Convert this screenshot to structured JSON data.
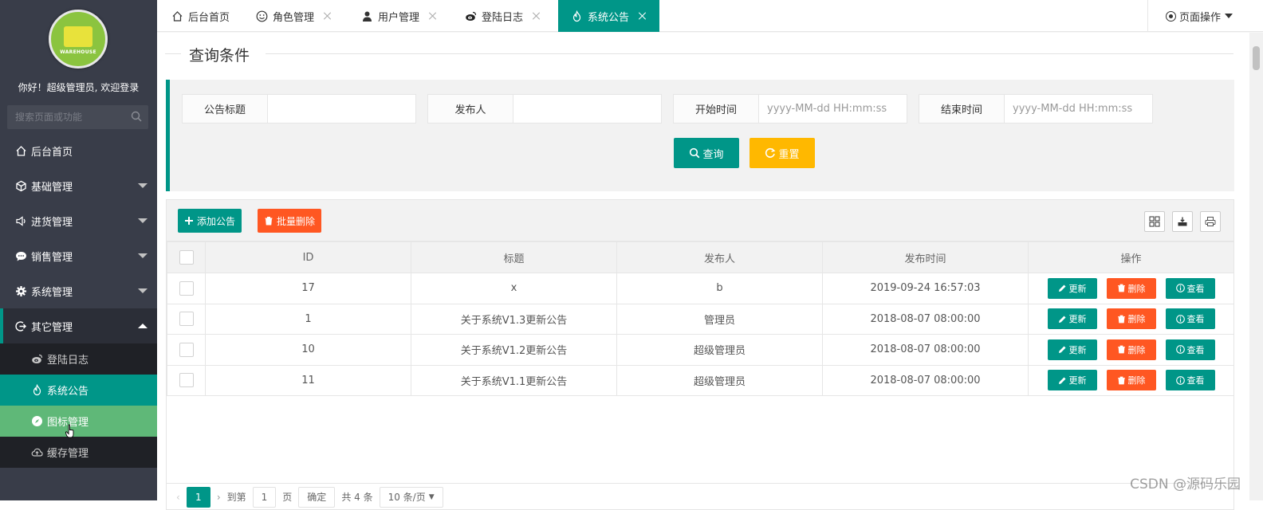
{
  "sidebar": {
    "logo_text": "WAREHOUSE",
    "welcome": "你好！超级管理员, 欢迎登录",
    "search_placeholder": "搜索页面或功能",
    "menu": [
      {
        "label": "后台首页",
        "icon": "home-icon"
      },
      {
        "label": "基础管理",
        "icon": "cube-icon",
        "expandable": true
      },
      {
        "label": "进货管理",
        "icon": "speaker-icon",
        "expandable": true
      },
      {
        "label": "销售管理",
        "icon": "chat-icon",
        "expandable": true
      },
      {
        "label": "系统管理",
        "icon": "gear-icon",
        "expandable": true
      },
      {
        "label": "其它管理",
        "icon": "exit-icon",
        "expandable": true,
        "open": true
      }
    ],
    "submenu": [
      {
        "label": "登陆日志",
        "icon": "weibo-icon"
      },
      {
        "label": "系统公告",
        "icon": "fire-icon",
        "state": "active"
      },
      {
        "label": "图标管理",
        "icon": "compass-icon",
        "state": "hover"
      },
      {
        "label": "缓存管理",
        "icon": "cloud-icon"
      }
    ]
  },
  "tabs": [
    {
      "label": "后台首页",
      "icon": "home-icon",
      "closable": false
    },
    {
      "label": "角色管理",
      "icon": "smile-icon",
      "closable": true
    },
    {
      "label": "用户管理",
      "icon": "user-icon",
      "closable": true
    },
    {
      "label": "登陆日志",
      "icon": "weibo-icon",
      "closable": true
    },
    {
      "label": "系统公告",
      "icon": "fire-icon",
      "closable": true,
      "active": true
    }
  ],
  "page_ops": "页面操作",
  "query": {
    "legend": "查询条件",
    "fields": [
      {
        "label": "公告标题",
        "placeholder": ""
      },
      {
        "label": "发布人",
        "placeholder": ""
      },
      {
        "label": "开始时间",
        "placeholder": "yyyy-MM-dd HH:mm:ss"
      },
      {
        "label": "结束时间",
        "placeholder": "yyyy-MM-dd HH:mm:ss"
      }
    ],
    "search_label": "查询",
    "reset_label": "重置"
  },
  "toolbar": {
    "add_label": "添加公告",
    "batch_delete_label": "批量删除"
  },
  "table": {
    "columns": [
      "ID",
      "标题",
      "发布人",
      "发布时间",
      "操作"
    ],
    "rows": [
      {
        "id": "17",
        "title": "x",
        "publisher": "b",
        "time": "2019-09-24 16:57:03"
      },
      {
        "id": "1",
        "title": "关于系统V1.3更新公告",
        "publisher": "管理员",
        "time": "2018-08-07 08:00:00"
      },
      {
        "id": "10",
        "title": "关于系统V1.2更新公告",
        "publisher": "超级管理员",
        "time": "2018-08-07 08:00:00"
      },
      {
        "id": "11",
        "title": "关于系统V1.1更新公告",
        "publisher": "超级管理员",
        "time": "2018-08-07 08:00:00"
      }
    ],
    "actions": {
      "update": "更新",
      "delete": "删除",
      "view": "查看"
    }
  },
  "pager": {
    "current": "1",
    "goto_prefix": "到第",
    "goto_value": "1",
    "goto_suffix": "页",
    "confirm": "确定",
    "total": "共 4 条",
    "per_page": "10 条/页"
  },
  "watermark": "CSDN @源码乐园",
  "colors": {
    "sidebar_bg": "#393d49",
    "primary": "#009688",
    "warn": "#ffb800",
    "danger": "#ff5722",
    "hover": "#5fb878"
  }
}
